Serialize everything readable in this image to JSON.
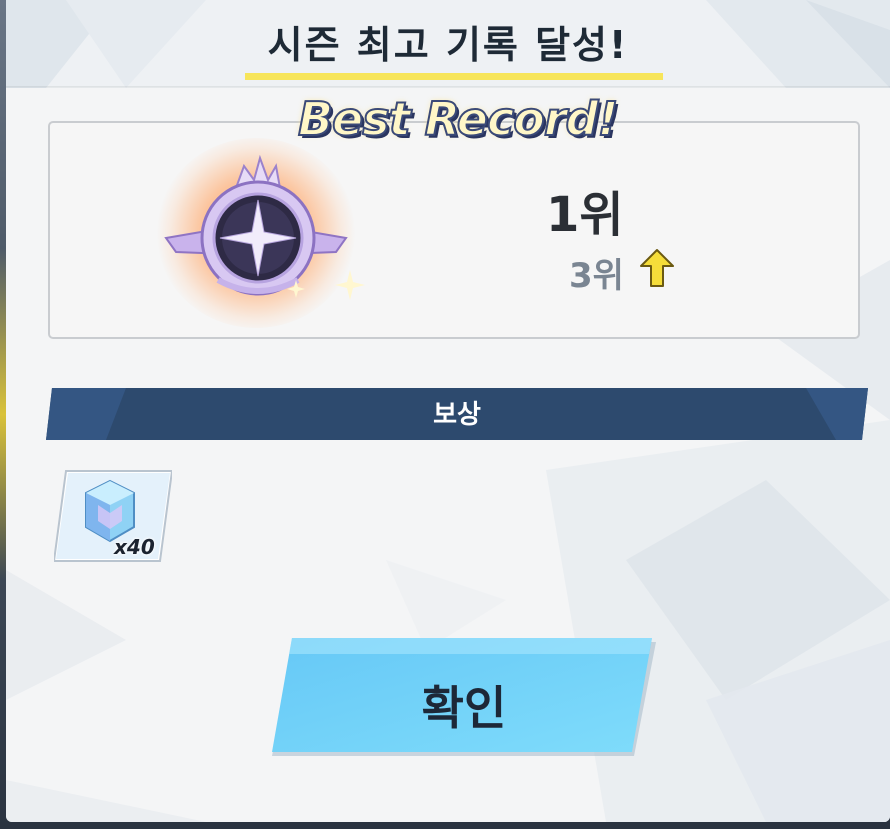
{
  "header": {
    "title": "시즌 최고 기록 달성!"
  },
  "record": {
    "banner": "Best Record!",
    "emblem_icon": "rank-emblem-icon",
    "current_rank": "1위",
    "previous_rank": "3위",
    "change_icon": "up-arrow-icon"
  },
  "reward": {
    "section_label": "보상",
    "items": [
      {
        "icon": "crystal-gem-icon",
        "quantity": "x40"
      }
    ]
  },
  "actions": {
    "confirm_label": "확인"
  },
  "colors": {
    "title_underline": "#f7e55a",
    "reward_bar": "#2d4a6e",
    "confirm_button": "#6fd0f8",
    "rank_up": "#f5dd3a"
  }
}
